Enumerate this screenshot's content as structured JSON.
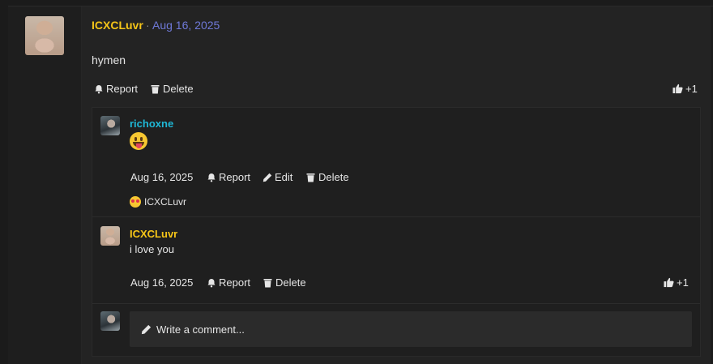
{
  "post": {
    "author": "ICXCLuvr",
    "separator": "·",
    "date": "Aug 16, 2025",
    "body": "hymen",
    "actions": {
      "report": "Report",
      "delete": "Delete"
    },
    "like_count": "+1",
    "author_color": "#f5c518",
    "date_color": "#6f79d8"
  },
  "comments": [
    {
      "author": "richoxne",
      "author_color": "#1fb8d6",
      "content_emoji": "face-with-tongue",
      "date": "Aug 16, 2025",
      "actions": {
        "report": "Report",
        "edit": "Edit",
        "delete": "Delete"
      },
      "reaction": {
        "icon": "star-struck-emoji",
        "user": "ICXCLuvr"
      }
    },
    {
      "author": "ICXCLuvr",
      "author_color": "#f5c518",
      "text": "i love you",
      "date": "Aug 16, 2025",
      "actions": {
        "report": "Report",
        "delete": "Delete"
      },
      "like_count": "+1"
    }
  ],
  "composer": {
    "placeholder": "Write a comment..."
  },
  "icons": [
    "bell-icon",
    "trash-icon",
    "pencil-icon",
    "thumbs-up-icon"
  ]
}
